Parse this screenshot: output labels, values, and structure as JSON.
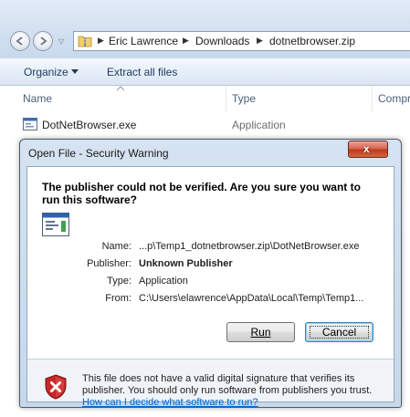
{
  "explorer": {
    "breadcrumbs": [
      "Eric Lawrence",
      "Downloads",
      "dotnetbrowser.zip"
    ],
    "toolbar": {
      "organize": "Organize",
      "extract": "Extract all files"
    },
    "columns": {
      "name": "Name",
      "type": "Type",
      "compressed": "Compr"
    },
    "file": {
      "name": "DotNetBrowser.exe",
      "type": "Application"
    }
  },
  "dialog": {
    "title": "Open File - Security Warning",
    "close_label": "x",
    "heading": "The publisher could not be verified.  Are you sure you want to run this software?",
    "fields": {
      "name_label": "Name:",
      "name_value": "...p\\Temp1_dotnetbrowser.zip\\DotNetBrowser.exe",
      "publisher_label": "Publisher:",
      "publisher_value": "Unknown Publisher",
      "type_label": "Type:",
      "type_value": "Application",
      "from_label": "From:",
      "from_value": "C:\\Users\\elawrence\\AppData\\Local\\Temp\\Temp1..."
    },
    "run_label": "Run",
    "cancel_label": "Cancel",
    "warning_text": "This file does not have a valid digital signature that verifies its publisher.  You should only run software from publishers you trust.",
    "help_link": "How can I decide what software to run?"
  },
  "colors": {
    "accent": "#1e395b",
    "link": "#0066cc",
    "close_button": "#c0361f",
    "shield": "#c62828"
  }
}
